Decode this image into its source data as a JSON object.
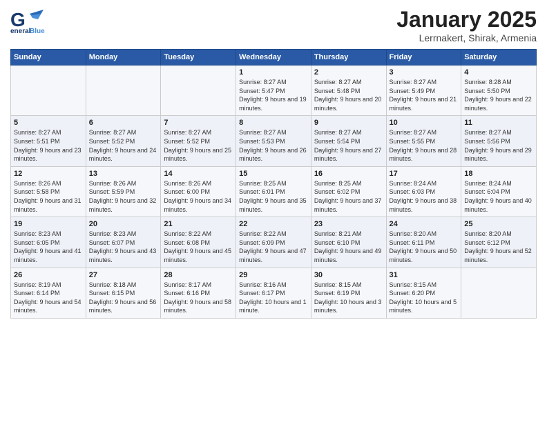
{
  "header": {
    "logo_general": "General",
    "logo_blue": "Blue",
    "month_title": "January 2025",
    "subtitle": "Lerrnakert, Shirak, Armenia"
  },
  "weekdays": [
    "Sunday",
    "Monday",
    "Tuesday",
    "Wednesday",
    "Thursday",
    "Friday",
    "Saturday"
  ],
  "weeks": [
    [
      {
        "day": "",
        "info": ""
      },
      {
        "day": "",
        "info": ""
      },
      {
        "day": "",
        "info": ""
      },
      {
        "day": "1",
        "info": "Sunrise: 8:27 AM\nSunset: 5:47 PM\nDaylight: 9 hours\nand 19 minutes."
      },
      {
        "day": "2",
        "info": "Sunrise: 8:27 AM\nSunset: 5:48 PM\nDaylight: 9 hours\nand 20 minutes."
      },
      {
        "day": "3",
        "info": "Sunrise: 8:27 AM\nSunset: 5:49 PM\nDaylight: 9 hours\nand 21 minutes."
      },
      {
        "day": "4",
        "info": "Sunrise: 8:28 AM\nSunset: 5:50 PM\nDaylight: 9 hours\nand 22 minutes."
      }
    ],
    [
      {
        "day": "5",
        "info": "Sunrise: 8:27 AM\nSunset: 5:51 PM\nDaylight: 9 hours\nand 23 minutes."
      },
      {
        "day": "6",
        "info": "Sunrise: 8:27 AM\nSunset: 5:52 PM\nDaylight: 9 hours\nand 24 minutes."
      },
      {
        "day": "7",
        "info": "Sunrise: 8:27 AM\nSunset: 5:52 PM\nDaylight: 9 hours\nand 25 minutes."
      },
      {
        "day": "8",
        "info": "Sunrise: 8:27 AM\nSunset: 5:53 PM\nDaylight: 9 hours\nand 26 minutes."
      },
      {
        "day": "9",
        "info": "Sunrise: 8:27 AM\nSunset: 5:54 PM\nDaylight: 9 hours\nand 27 minutes."
      },
      {
        "day": "10",
        "info": "Sunrise: 8:27 AM\nSunset: 5:55 PM\nDaylight: 9 hours\nand 28 minutes."
      },
      {
        "day": "11",
        "info": "Sunrise: 8:27 AM\nSunset: 5:56 PM\nDaylight: 9 hours\nand 29 minutes."
      }
    ],
    [
      {
        "day": "12",
        "info": "Sunrise: 8:26 AM\nSunset: 5:58 PM\nDaylight: 9 hours\nand 31 minutes."
      },
      {
        "day": "13",
        "info": "Sunrise: 8:26 AM\nSunset: 5:59 PM\nDaylight: 9 hours\nand 32 minutes."
      },
      {
        "day": "14",
        "info": "Sunrise: 8:26 AM\nSunset: 6:00 PM\nDaylight: 9 hours\nand 34 minutes."
      },
      {
        "day": "15",
        "info": "Sunrise: 8:25 AM\nSunset: 6:01 PM\nDaylight: 9 hours\nand 35 minutes."
      },
      {
        "day": "16",
        "info": "Sunrise: 8:25 AM\nSunset: 6:02 PM\nDaylight: 9 hours\nand 37 minutes."
      },
      {
        "day": "17",
        "info": "Sunrise: 8:24 AM\nSunset: 6:03 PM\nDaylight: 9 hours\nand 38 minutes."
      },
      {
        "day": "18",
        "info": "Sunrise: 8:24 AM\nSunset: 6:04 PM\nDaylight: 9 hours\nand 40 minutes."
      }
    ],
    [
      {
        "day": "19",
        "info": "Sunrise: 8:23 AM\nSunset: 6:05 PM\nDaylight: 9 hours\nand 41 minutes."
      },
      {
        "day": "20",
        "info": "Sunrise: 8:23 AM\nSunset: 6:07 PM\nDaylight: 9 hours\nand 43 minutes."
      },
      {
        "day": "21",
        "info": "Sunrise: 8:22 AM\nSunset: 6:08 PM\nDaylight: 9 hours\nand 45 minutes."
      },
      {
        "day": "22",
        "info": "Sunrise: 8:22 AM\nSunset: 6:09 PM\nDaylight: 9 hours\nand 47 minutes."
      },
      {
        "day": "23",
        "info": "Sunrise: 8:21 AM\nSunset: 6:10 PM\nDaylight: 9 hours\nand 49 minutes."
      },
      {
        "day": "24",
        "info": "Sunrise: 8:20 AM\nSunset: 6:11 PM\nDaylight: 9 hours\nand 50 minutes."
      },
      {
        "day": "25",
        "info": "Sunrise: 8:20 AM\nSunset: 6:12 PM\nDaylight: 9 hours\nand 52 minutes."
      }
    ],
    [
      {
        "day": "26",
        "info": "Sunrise: 8:19 AM\nSunset: 6:14 PM\nDaylight: 9 hours\nand 54 minutes."
      },
      {
        "day": "27",
        "info": "Sunrise: 8:18 AM\nSunset: 6:15 PM\nDaylight: 9 hours\nand 56 minutes."
      },
      {
        "day": "28",
        "info": "Sunrise: 8:17 AM\nSunset: 6:16 PM\nDaylight: 9 hours\nand 58 minutes."
      },
      {
        "day": "29",
        "info": "Sunrise: 8:16 AM\nSunset: 6:17 PM\nDaylight: 10 hours\nand 1 minute."
      },
      {
        "day": "30",
        "info": "Sunrise: 8:15 AM\nSunset: 6:19 PM\nDaylight: 10 hours\nand 3 minutes."
      },
      {
        "day": "31",
        "info": "Sunrise: 8:15 AM\nSunset: 6:20 PM\nDaylight: 10 hours\nand 5 minutes."
      },
      {
        "day": "",
        "info": ""
      }
    ]
  ]
}
